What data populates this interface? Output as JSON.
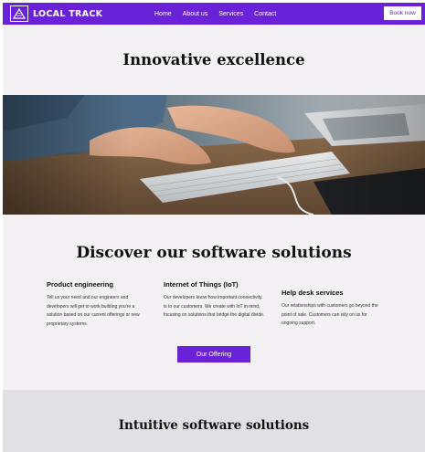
{
  "header": {
    "logo_text": "LOCAL TRACK",
    "nav": [
      "Home",
      "About us",
      "Services",
      "Contact"
    ],
    "book_label": "Book now"
  },
  "hero": {
    "title": "Innovative excellence"
  },
  "solutions": {
    "title": "Discover our software solutions",
    "items": [
      {
        "title": "Product engineering",
        "text": "Tell us your need and our engineers and developers will get to work building you're a solution based on our current offerings or new proprietary systems."
      },
      {
        "title": "Internet of Things (IoT)",
        "text": "Our developers know how important connectivity is to our customers. We create with IoT in mind, focusing on solutions that bridge the digital divide."
      },
      {
        "title": "Help desk services",
        "text": "Our relationships with customers go beyond the point of sale. Customers can rely on us for ongoing support."
      }
    ],
    "cta_label": "Our Offering"
  },
  "bottom": {
    "title": "Intuitive software solutions"
  },
  "colors": {
    "accent": "#6a22d8",
    "page_background": "#f3f1f4",
    "bottom_section": "#e1e0e3"
  },
  "icons": {
    "logo": "triangle-logo-icon"
  }
}
